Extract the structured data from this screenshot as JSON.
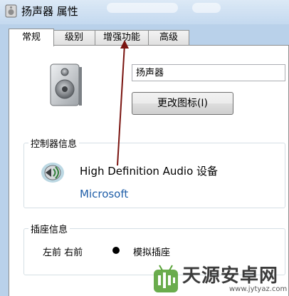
{
  "window": {
    "title": "扬声器 属性",
    "icon": "speaker-icon"
  },
  "tabs": [
    {
      "label": "常规",
      "active": true
    },
    {
      "label": "级别",
      "active": false
    },
    {
      "label": "增强功能",
      "active": false
    },
    {
      "label": "高级",
      "active": false
    }
  ],
  "general": {
    "device_label_value": "扬声器",
    "change_icon_button": "更改图标(I)"
  },
  "controller": {
    "group_title": "控制器信息",
    "device_name": "High Definition Audio 设备",
    "vendor": "Microsoft",
    "icon": "audio-device-icon"
  },
  "jack": {
    "group_title": "插座信息",
    "position": "左前 右前",
    "type": "模拟插座",
    "color": "#000000"
  },
  "annotation": {
    "arrow_color": "#7a1410",
    "arrow_target": "增强功能"
  },
  "watermark": {
    "text": "天源安卓网",
    "url": "www.jytyaz.com",
    "icon": "android-logo-icon"
  }
}
